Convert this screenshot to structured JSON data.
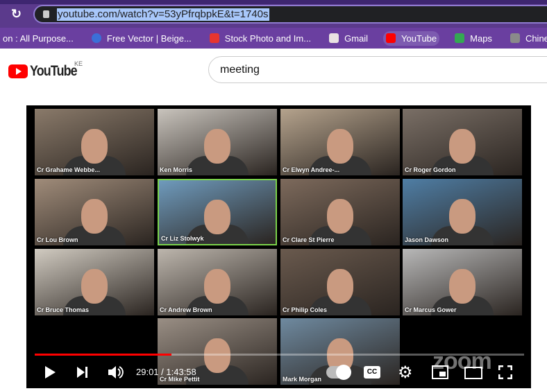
{
  "browser": {
    "url": "youtube.com/watch?v=53yPfrqbpkE&t=1740s",
    "bookmarks": [
      {
        "label": "on : All Purpose...",
        "icon": "none",
        "color": ""
      },
      {
        "label": "Free Vector | Beige...",
        "icon": "globe-icon",
        "color": "#3b6fd8"
      },
      {
        "label": "Stock Photo and Im...",
        "icon": "shutterstock-icon",
        "color": "#e8352e"
      },
      {
        "label": "Gmail",
        "icon": "gmail-icon",
        "color": "#e9e2e2"
      },
      {
        "label": "YouTube",
        "icon": "youtube-icon",
        "color": "#ff0000"
      },
      {
        "label": "Maps",
        "icon": "maps-icon",
        "color": "#34a853"
      },
      {
        "label": "Chinese Anime - W...",
        "icon": "anime-icon",
        "color": "#8a8a8a"
      }
    ]
  },
  "youtube": {
    "logo": "YouTube",
    "country": "KE",
    "search_value": "meeting"
  },
  "video": {
    "participants": [
      {
        "name": "Cr Grahame Webbe...",
        "bg": "#8a7a6a"
      },
      {
        "name": "Ken Morris",
        "bg": "#c9c4bd"
      },
      {
        "name": "Cr Elwyn Andree-...",
        "bg": "#b5a38d"
      },
      {
        "name": "Cr Roger Gordon",
        "bg": "#7a6f66"
      },
      {
        "name": "Cr Lou Brown",
        "bg": "#a08c7a"
      },
      {
        "name": "Cr Liz Stolwyk",
        "bg": "#6f9bbd",
        "speaking": true
      },
      {
        "name": "Cr Clare St Pierre",
        "bg": "#7d6a5c"
      },
      {
        "name": "Jason Dawson",
        "bg": "#4f7ea5"
      },
      {
        "name": "Cr Bruce Thomas",
        "bg": "#d1cbc1"
      },
      {
        "name": "Cr Andrew Brown",
        "bg": "#bdb6ad"
      },
      {
        "name": "Cr Philip Coles",
        "bg": "#6a5a4e"
      },
      {
        "name": "Cr Marcus Gower",
        "bg": "#b8b8b8"
      },
      {
        "name": "Cr Mike Pettit",
        "bg": "#9a8f85"
      },
      {
        "name": "Mark Morgan",
        "bg": "#6f8aa0"
      }
    ],
    "current_time": "29:01",
    "duration": "1:43:58",
    "time_separator": " / ",
    "progress_fraction": 0.279,
    "buffered_fraction": 0.3,
    "watermark": "zoom",
    "accent": "#ff0000"
  }
}
